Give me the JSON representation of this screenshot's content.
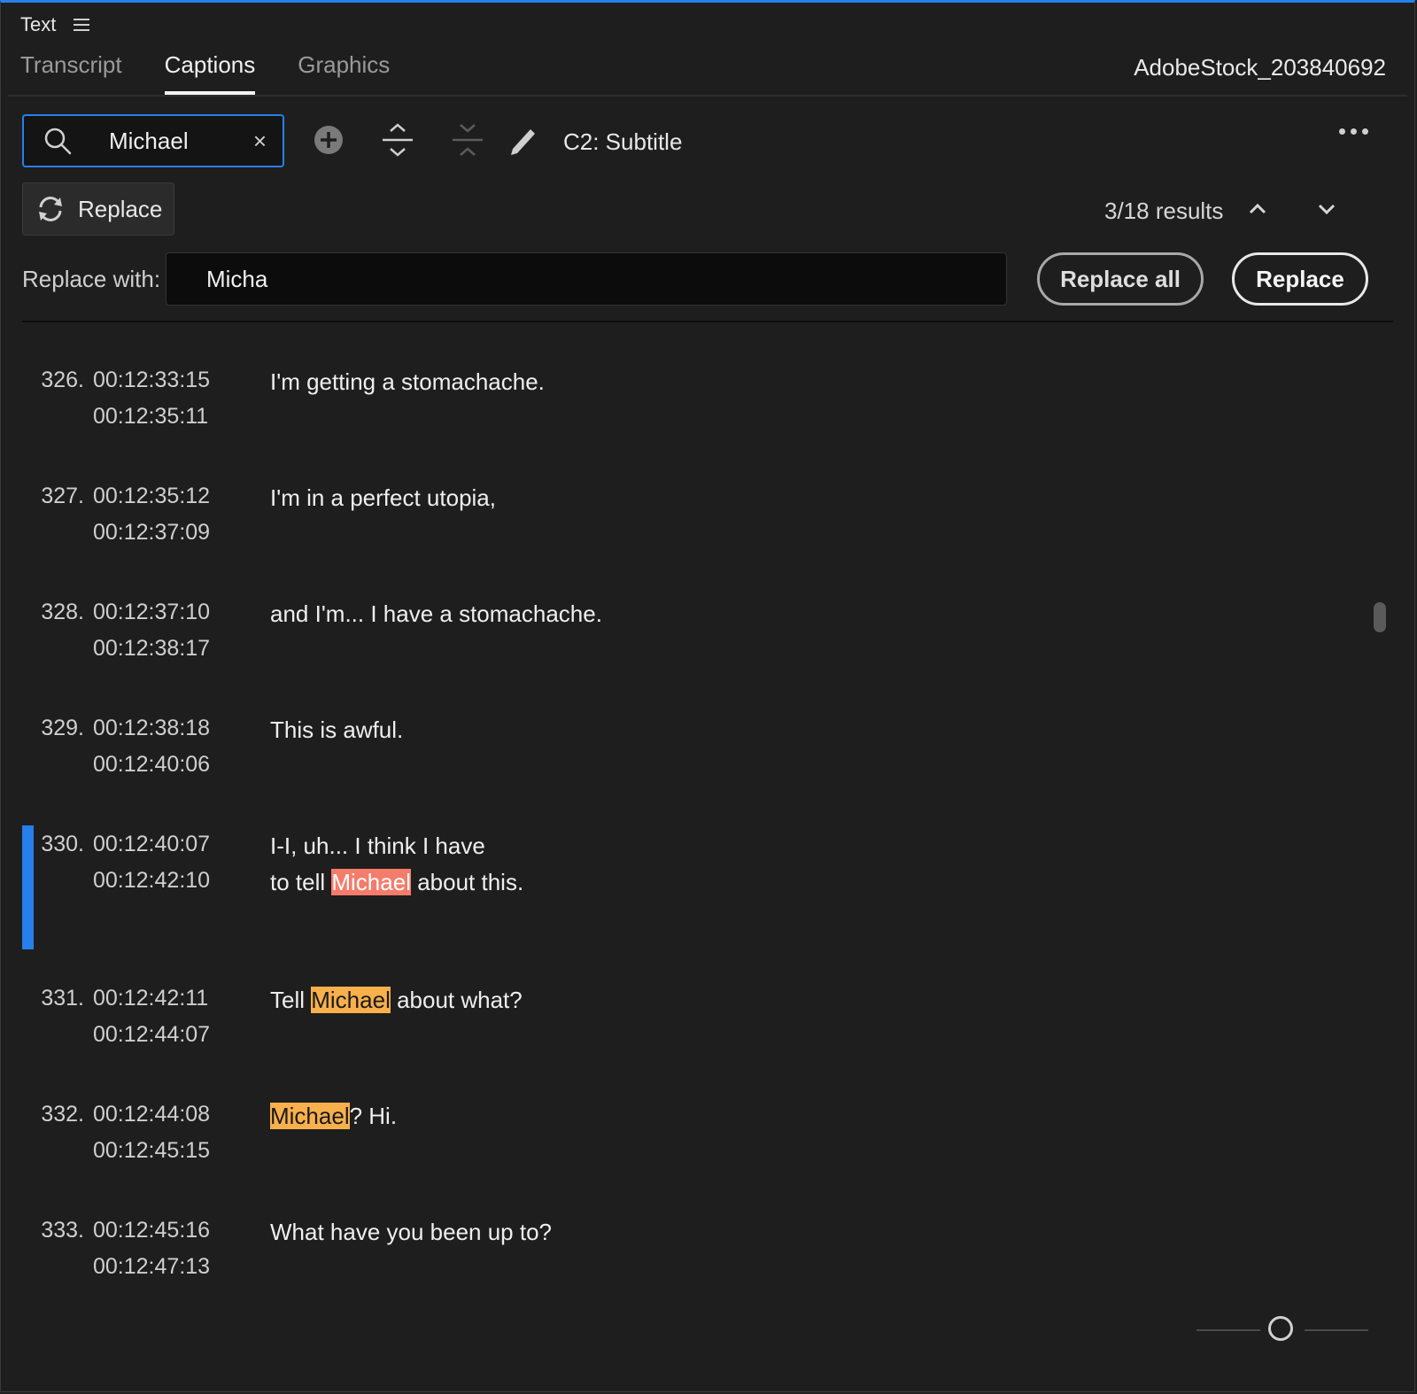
{
  "panel": {
    "title": "Text"
  },
  "tabs": [
    {
      "label": "Transcript",
      "active": false
    },
    {
      "label": "Captions",
      "active": true
    },
    {
      "label": "Graphics",
      "active": false
    }
  ],
  "clip_name": "AdobeStock_203840692",
  "search": {
    "value": "Michael",
    "clear_label": "×"
  },
  "toolbar": {
    "track_label": "C2: Subtitle"
  },
  "replace_toggle": {
    "label": "Replace"
  },
  "results": {
    "text": "3/18 results"
  },
  "replace_row": {
    "label": "Replace with:",
    "value": "Micha",
    "replace_all_label": "Replace all",
    "replace_label": "Replace"
  },
  "captions": [
    {
      "num": "326.",
      "in": "00:12:33:15",
      "out": "00:12:35:11",
      "lines": [
        "I'm getting a stomachache."
      ]
    },
    {
      "num": "327.",
      "in": "00:12:35:12",
      "out": "00:12:37:09",
      "lines": [
        "I'm in a perfect utopia,"
      ]
    },
    {
      "num": "328.",
      "in": "00:12:37:10",
      "out": "00:12:38:17",
      "lines": [
        "and I'm... I have a stomachache."
      ]
    },
    {
      "num": "329.",
      "in": "00:12:38:18",
      "out": "00:12:40:06",
      "lines": [
        "This is awful."
      ]
    },
    {
      "num": "330.",
      "in": "00:12:40:07",
      "out": "00:12:42:10",
      "selected": true,
      "line1": "I-I, uh... I think I have",
      "line2_pre": "to tell ",
      "line2_match": "Michael",
      "line2_post": " about this."
    },
    {
      "num": "331.",
      "in": "00:12:42:11",
      "out": "00:12:44:07",
      "pre": "Tell ",
      "match": "Michael",
      "post": " about what?"
    },
    {
      "num": "332.",
      "in": "00:12:44:08",
      "out": "00:12:45:15",
      "pre": "",
      "match": "Michael",
      "post": "? Hi."
    },
    {
      "num": "333.",
      "in": "00:12:45:16",
      "out": "00:12:47:13",
      "lines": [
        "What have you been up to?"
      ]
    }
  ],
  "colors": {
    "accent": "#2680eb",
    "current_match": "#f47c6b",
    "other_match": "#f8b04c"
  },
  "icons": [
    "search-icon",
    "clear-icon",
    "add-caption-icon",
    "split-caption-icon",
    "merge-caption-icon",
    "pencil-icon",
    "more-icon",
    "replace-icon",
    "chevron-up-icon",
    "chevron-down-icon",
    "menu-icon"
  ]
}
